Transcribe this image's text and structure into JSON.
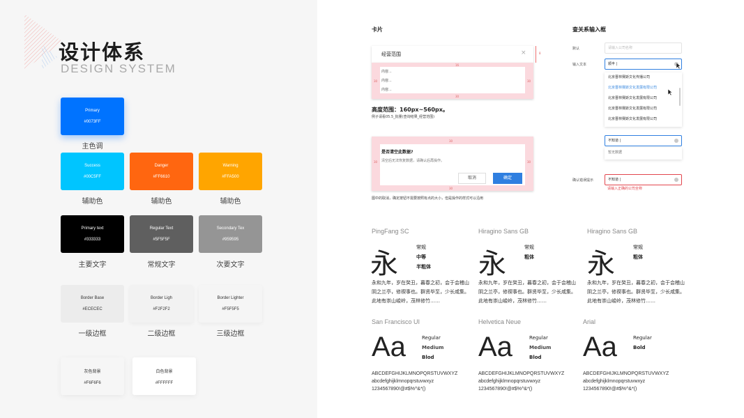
{
  "header": {
    "title_cn": "设计体系",
    "title_en": "DESIGN SYSTEM"
  },
  "swatches": [
    {
      "name": "Primary",
      "hex": "#0073FF",
      "caption": "主色调",
      "color": "#0073FF"
    },
    {
      "name": "Success",
      "hex": "#00C5FF",
      "caption": "辅助色",
      "color": "#00C5FF"
    },
    {
      "name": "Danger",
      "hex": "#FF6610",
      "caption": "辅助色",
      "color": "#FF6610"
    },
    {
      "name": "Warning",
      "hex": "#FFA500",
      "caption": "辅助色",
      "color": "#FFA500"
    },
    {
      "name": "Primary text",
      "hex": "#333333",
      "caption": "主要文字",
      "color": "#000000"
    },
    {
      "name": "Regular Text",
      "hex": "#5F5F5F",
      "caption": "常规文字",
      "color": "#5F5F5F"
    },
    {
      "name": "Secondary Tex",
      "hex": "#959595",
      "caption": "次要文字",
      "color": "#959595"
    },
    {
      "name": "Border Base",
      "hex": "#ECECEC",
      "caption": "一级边框",
      "color": "#ECECEC"
    },
    {
      "name": "Border Ligh",
      "hex": "#F2F2F2",
      "caption": "二级边框",
      "color": "#F2F2F2"
    },
    {
      "name": "Border Lighter",
      "hex": "#F5F5F5",
      "caption": "三级边框",
      "color": "#F5F5F5"
    },
    {
      "name": "灰色背景",
      "hex": "#F6F6F6",
      "caption": "",
      "color": "#F6F6F6"
    },
    {
      "name": "白色背景",
      "hex": "#FFFFFF",
      "caption": "",
      "color": "#FFFFFF"
    }
  ],
  "card": {
    "section_title": "卡片",
    "card1_title": "经营范围",
    "close_icon": "×",
    "content_lines": [
      "内容...",
      "内容...",
      "内容..."
    ],
    "spacing": {
      "s16": "16",
      "s30": "30",
      "s8": "8"
    },
    "height_range": "高度范围：160px~560px。",
    "height_note": "例子请看05.5_批量(查询结果_经营范围)",
    "dialog_title": "是否清空此数据?",
    "dialog_body": "清空后无法恢复数据，请确认后再操作。",
    "cancel": "取消",
    "confirm": "确定",
    "footer_note": "图中的取消，确定按钮不需要按照有点的大小，但是操作的样式可以沿用"
  },
  "search_input": {
    "section_title": "查关系输入框",
    "default_label": "默认",
    "default_placeholder": "请输入公司名称",
    "input_label": "输入文本",
    "input_value": "顺丰 |",
    "suggestions": [
      "北京晋林赛斯文化传播公司",
      "北京晋林赛斯文化发展有限公司",
      "北京晋林赛斯文化发展有限公司",
      "北京晋林赛斯文化发展有限公司",
      "北京晋林赛斯文化发展有限公司"
    ],
    "not_found_value": "不知道 |",
    "no_data": "暂无数据",
    "error_label": "确认错误提示",
    "error_value": "不知道 |",
    "error_msg": "请输入正确的公司全称"
  },
  "typography": {
    "cn_fonts": [
      {
        "name": "PingFang SC",
        "glyph": "永",
        "weights": [
          "常规",
          "中等",
          "半粗体"
        ]
      },
      {
        "name": "Hiragino Sans GB",
        "glyph": "永",
        "weights": [
          "常规",
          "粗体"
        ]
      },
      {
        "name": "Hiragino Sans GB",
        "glyph": "永",
        "weights": [
          "常规",
          "粗体"
        ]
      }
    ],
    "cn_sample": "永和九年，岁在癸丑，暮春之初，会于会稽山阴之兰亭，修禊事也。群贤毕至，少长咸集。此地有崇山峻岭，茂林修竹……",
    "en_fonts": [
      {
        "name": "San Francisco UI",
        "glyph": "Aa",
        "weights": [
          "Regular",
          "Medium",
          "Blod"
        ]
      },
      {
        "name": "Helvetica Neue",
        "glyph": "Aa",
        "weights": [
          "Regular",
          "Medium",
          "Blod"
        ]
      },
      {
        "name": "Arial",
        "glyph": "Aa",
        "weights": [
          "Regular",
          "Bold"
        ]
      }
    ],
    "upper": "ABCDEFGHIJKLMNOPQRSTUVWXYZ",
    "lower": "abcdefghijklmnopqrstuvwxyz",
    "digits": "1234567890!@#$%^&*()"
  }
}
